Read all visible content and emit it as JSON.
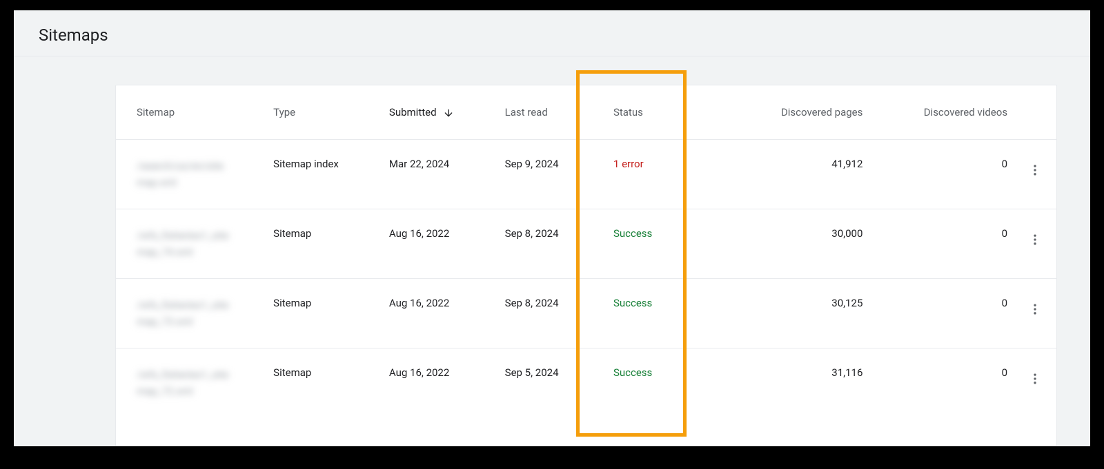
{
  "page": {
    "title": "Sitemaps"
  },
  "table": {
    "headers": {
      "sitemap": "Sitemap",
      "type": "Type",
      "submitted": "Submitted",
      "lastRead": "Last read",
      "status": "Status",
      "discoveredPages": "Discovered pages",
      "discoveredVideos": "Discovered videos"
    },
    "sortedColumn": "submitted",
    "sortDirection": "desc",
    "rows": [
      {
        "sitemap": "/search/us/en/site map.xml",
        "type": "Sitemap index",
        "submitted": "Mar 22, 2024",
        "lastRead": "Sep 9, 2024",
        "status": "1 error",
        "statusKind": "error",
        "discoveredPages": "41,912",
        "discoveredVideos": "0"
      },
      {
        "sitemap": "/wfs_fisheries1_site map_74.xml",
        "type": "Sitemap",
        "submitted": "Aug 16, 2022",
        "lastRead": "Sep 8, 2024",
        "status": "Success",
        "statusKind": "success",
        "discoveredPages": "30,000",
        "discoveredVideos": "0"
      },
      {
        "sitemap": "/wfs_fisheries1_site map_73.xml",
        "type": "Sitemap",
        "submitted": "Aug 16, 2022",
        "lastRead": "Sep 8, 2024",
        "status": "Success",
        "statusKind": "success",
        "discoveredPages": "30,125",
        "discoveredVideos": "0"
      },
      {
        "sitemap": "/wfs_fisheries1_site map_72.xml",
        "type": "Sitemap",
        "submitted": "Aug 16, 2022",
        "lastRead": "Sep 5, 2024",
        "status": "Success",
        "statusKind": "success",
        "discoveredPages": "31,116",
        "discoveredVideos": "0"
      }
    ]
  },
  "highlight": {
    "column": "status"
  }
}
